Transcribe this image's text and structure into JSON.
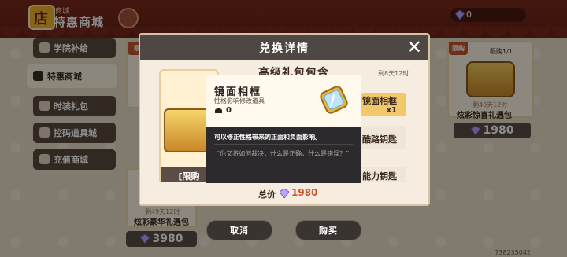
{
  "shop": {
    "sub_label": "商城",
    "title": "特惠商城",
    "currency_value": "0"
  },
  "sidebar": {
    "items": [
      {
        "label": "学院补给",
        "active": false
      },
      {
        "label": "特惠商城",
        "active": true
      },
      {
        "label": "时装礼包",
        "active": false
      },
      {
        "label": "控码道具城",
        "active": false
      },
      {
        "label": "充值商城",
        "active": false
      }
    ]
  },
  "background_cards": {
    "right_top": {
      "limit": "限购1/1",
      "time": "剩49天12时",
      "name": "炫彩惊喜礼遇包",
      "price": "1980"
    },
    "left_bottom": {
      "time": "剩49天12时",
      "name": "炫彩豪华礼遇包",
      "price": "3980"
    },
    "left_top_limit": "限"
  },
  "modal": {
    "title": "兑换详情",
    "pack_name": "高级礼包包含",
    "time_note": "剩8天12时",
    "limit_text": "[限购",
    "items": [
      {
        "name": "镜面相框",
        "qty": "x1",
        "highlight": true
      },
      {
        "name": "酷路钥匙",
        "qty": "",
        "highlight": false
      },
      {
        "name": "能力钥匙",
        "qty": "",
        "highlight": false
      }
    ],
    "total_label": "总价",
    "total_price": "1980"
  },
  "tooltip": {
    "name": "镜面相框",
    "type": "性格影响修改道具",
    "owned": "0",
    "description": "可以修正性格带来的正面和负面影响。",
    "quote": "“你又将如何裁决，什么是正确，什么是错误？”"
  },
  "buttons": {
    "cancel": "取消",
    "buy": "购买"
  },
  "footer_id": "738235042",
  "colors": {
    "accent": "#c9562f",
    "highlight": "#f1c96a",
    "header": "#4e4743"
  }
}
